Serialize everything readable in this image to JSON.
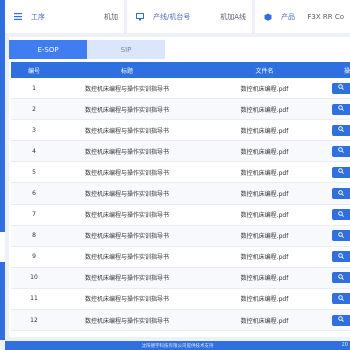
{
  "info_bar": {
    "process_label": "工序",
    "process_value": "机加",
    "line_label": "产线/机台号",
    "line_value": "机加A线",
    "product_label": "产品",
    "product_value": "F3X RR Co"
  },
  "tabs": [
    "E-SOP",
    "SIP"
  ],
  "table": {
    "headers": {
      "num": "编号",
      "title": "标题",
      "file": "文件名",
      "action": "操"
    },
    "rows": [
      {
        "num": "1",
        "title": "数控机床编程与操作实训指导书",
        "file": "数控机床编程.pdf"
      },
      {
        "num": "2",
        "title": "数控机床编程与操作实训指导书",
        "file": "数控机床编程.pdf"
      },
      {
        "num": "3",
        "title": "数控机床编程与操作实训指导书",
        "file": "数控机床编程.pdf"
      },
      {
        "num": "4",
        "title": "数控机床编程与操作实训指导书",
        "file": "数控机床编程.pdf"
      },
      {
        "num": "5",
        "title": "数控机床编程与操作实训指导书",
        "file": "数控机床编程.pdf"
      },
      {
        "num": "6",
        "title": "数控机床编程与操作实训指导书",
        "file": "数控机床编程.pdf"
      },
      {
        "num": "7",
        "title": "数控机床编程与操作实训指导书",
        "file": "数控机床编程.pdf"
      },
      {
        "num": "8",
        "title": "数控机床编程与操作实训指导书",
        "file": "数控机床编程.pdf"
      },
      {
        "num": "9",
        "title": "数控机床编程与操作实训指导书",
        "file": "数控机床编程.pdf"
      },
      {
        "num": "10",
        "title": "数控机床编程与操作实训指导书",
        "file": "数控机床编程.pdf"
      },
      {
        "num": "11",
        "title": "数控机床编程与操作实训指导书",
        "file": "数控机床编程.pdf"
      },
      {
        "num": "12",
        "title": "数控机床编程与操作实训指导书",
        "file": "数控机床编程.pdf"
      }
    ]
  },
  "footer": {
    "text": "沈阳德宇科技有限公司提供技术支持",
    "tail": "20"
  },
  "colors": {
    "primary": "#2f6fe0",
    "tab_active": "#3f7df0",
    "tab_inactive": "#dbe6fb",
    "background": "#eef1f7"
  },
  "icons": {
    "process": "list-icon",
    "line": "monitor-icon",
    "product": "box-icon",
    "view": "search-icon"
  }
}
